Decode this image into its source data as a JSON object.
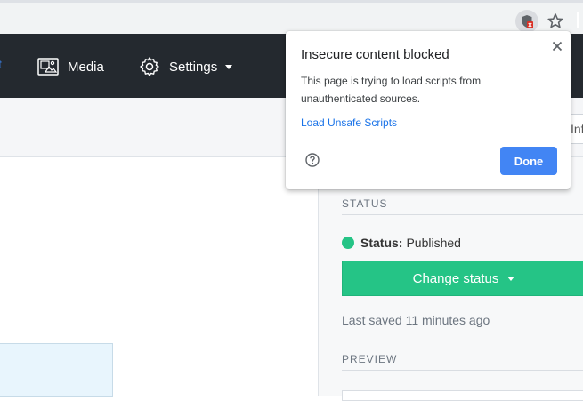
{
  "browser": {
    "icons": [
      "blocked-content-shield-icon",
      "bookmark-star-icon"
    ]
  },
  "nav": {
    "active_fragment": "t",
    "items": [
      {
        "label": "Media",
        "icon": "media-icon"
      },
      {
        "label": "Settings",
        "icon": "gear-icon",
        "has_dropdown": true
      }
    ]
  },
  "toolbar": {
    "info_fragment": "Inf"
  },
  "right_panel": {
    "status_heading": "STATUS",
    "status_label": "Status:",
    "status_value": "Published",
    "status_color": "#25c486",
    "change_status_label": "Change status",
    "last_saved": "Last saved 11 minutes ago",
    "preview_heading": "PREVIEW"
  },
  "popup": {
    "title": "Insecure content blocked",
    "message": "This page is trying to load scripts from unauthenticated sources.",
    "link_label": "Load Unsafe Scripts",
    "done_label": "Done",
    "accent": "#4285f4"
  },
  "colors": {
    "nav_bg": "#24292f",
    "button_green": "#25c486",
    "link_blue": "#1a73e8"
  }
}
